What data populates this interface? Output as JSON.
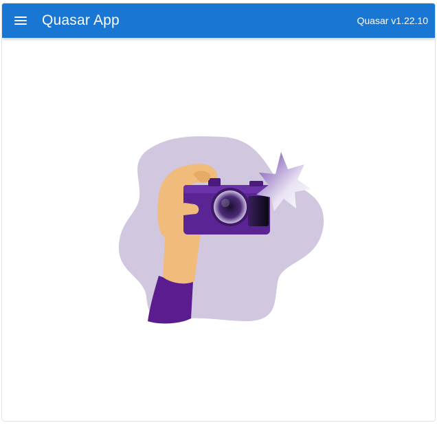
{
  "header": {
    "title": "Quasar App",
    "version": "Quasar v1.22.10",
    "menu_icon": "menu-icon"
  },
  "colors": {
    "header_bg": "#1976d2",
    "blob": "#d1c8df",
    "camera": "#5b2494",
    "sleeve": "#5b1c8f",
    "skin": "#f1bb7b"
  },
  "illustration": {
    "icon": "camera-photo-illustration"
  }
}
